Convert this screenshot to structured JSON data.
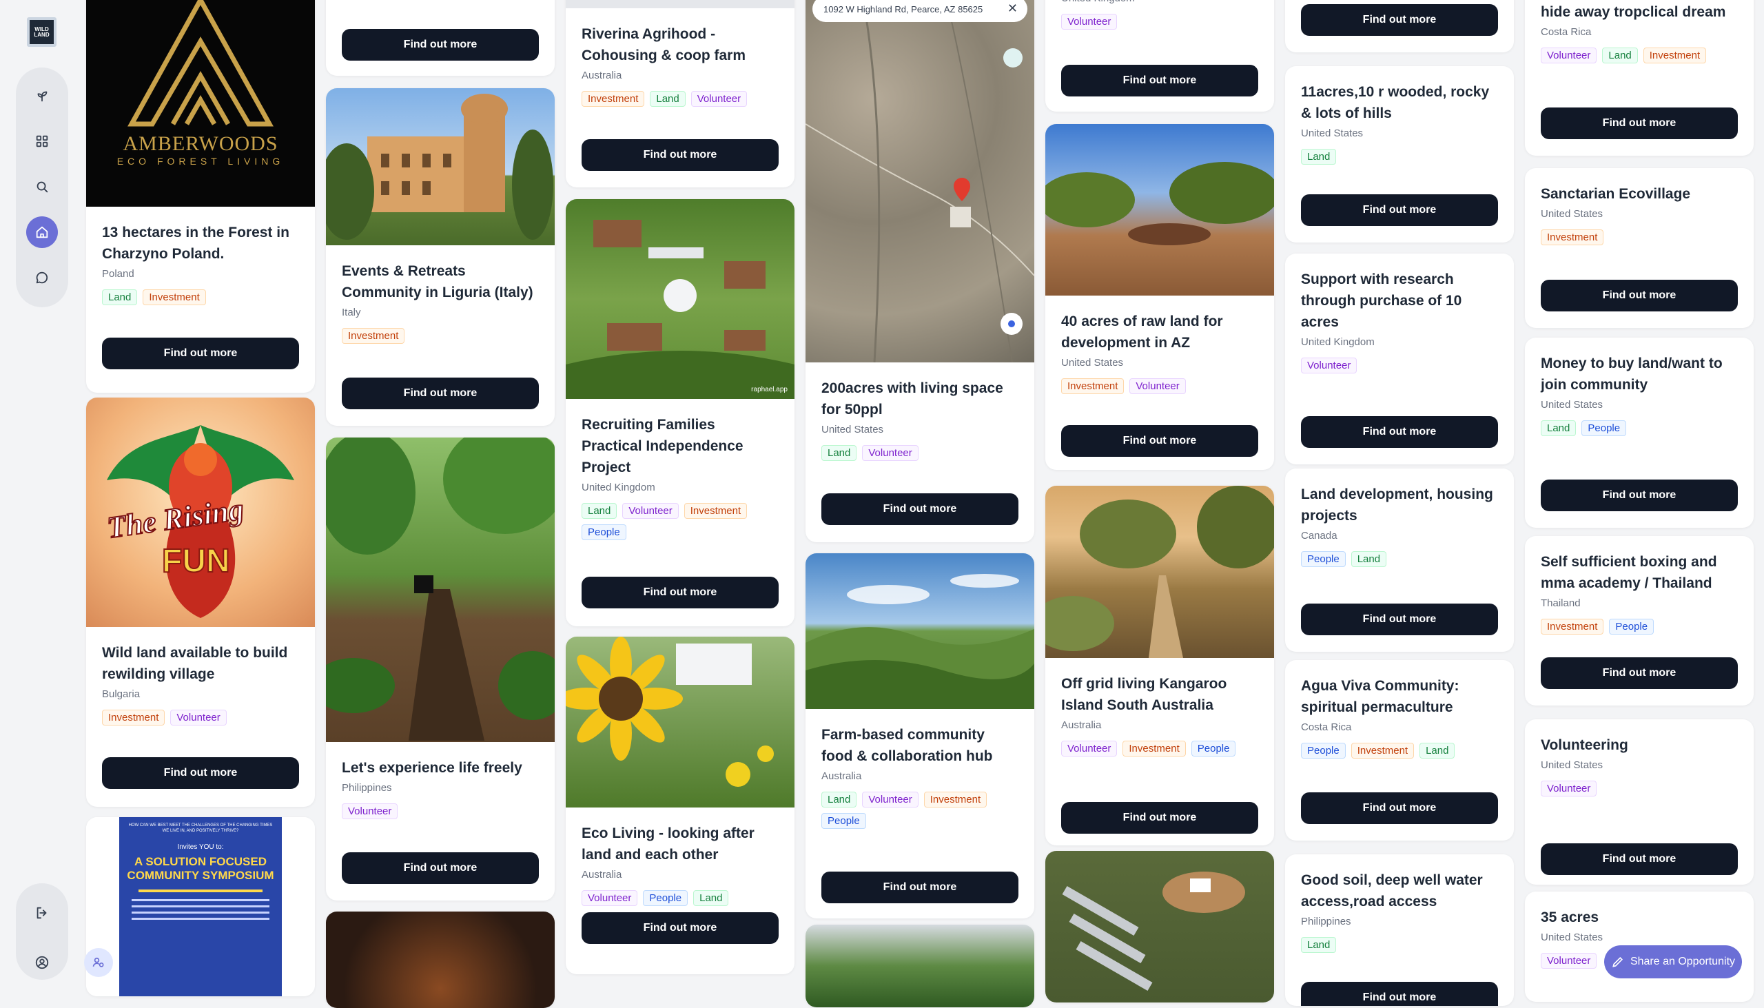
{
  "sidebar": {
    "logo_text": "WILD\nLAND",
    "nav": [
      {
        "name": "sprout-icon"
      },
      {
        "name": "grid-icon"
      },
      {
        "name": "search-icon"
      },
      {
        "name": "home-icon",
        "active": true
      },
      {
        "name": "chat-icon"
      }
    ],
    "bottom": [
      {
        "name": "logout-icon"
      },
      {
        "name": "user-circle-icon"
      }
    ]
  },
  "cta_label": "Find out more",
  "share_label": "Share an Opportunity",
  "map_address": "1092 W Highland Rd, Pearce, AZ 85625",
  "columns": [
    [
      {
        "title": "13 hectares in the Forest in Charzyno Poland.",
        "country": "Poland",
        "tags": [
          "Land",
          "Investment"
        ],
        "img": "amberwoods"
      },
      {
        "title": "Wild land available to build rewilding village",
        "country": "Bulgaria",
        "tags": [
          "Investment",
          "Volunteer"
        ],
        "img": "phoenix"
      },
      {
        "title": "",
        "country": "",
        "tags": [],
        "img": "poster"
      }
    ],
    [
      {
        "title": "",
        "country": "",
        "tags": [],
        "img": ""
      },
      {
        "title": "Events & Retreats Community in Liguria (Italy)",
        "country": "Italy",
        "tags": [
          "Investment"
        ],
        "img": "castle"
      },
      {
        "title": "Let's experience life freely",
        "country": "Philippines",
        "tags": [
          "Volunteer"
        ],
        "img": "garden"
      },
      {
        "title": "",
        "country": "",
        "tags": [],
        "img": "dark"
      }
    ],
    [
      {
        "title": "Riverina Agrihood - Cohousing & coop farm",
        "country": "Australia",
        "tags": [
          "Investment",
          "Land",
          "Volunteer"
        ],
        "img": ""
      },
      {
        "title": "Recruiting Families Practical Independence Project",
        "country": "United Kingdom",
        "tags": [
          "Land",
          "Volunteer",
          "Investment",
          "People"
        ],
        "img": "farm"
      },
      {
        "title": "Eco Living - looking after land and each other",
        "country": "Australia",
        "tags": [
          "Volunteer",
          "People",
          "Land"
        ],
        "img": "sunflower"
      }
    ],
    [
      {
        "title": "200acres with living space for 50ppl",
        "country": "United States",
        "tags": [
          "Land",
          "Volunteer"
        ],
        "img": "map"
      },
      {
        "title": "Farm-based community food & collaboration hub",
        "country": "Australia",
        "tags": [
          "Land",
          "Volunteer",
          "Investment",
          "People"
        ],
        "img": "hills"
      },
      {
        "title": "",
        "country": "",
        "tags": [],
        "img": "forest"
      }
    ],
    [
      {
        "title": "",
        "country": "United Kingdom",
        "tags": [
          "Volunteer"
        ],
        "img": ""
      },
      {
        "title": "40 acres of raw land for development in AZ",
        "country": "United States",
        "tags": [
          "Investment",
          "Volunteer"
        ],
        "img": "desert"
      },
      {
        "title": "Off grid living Kangaroo Island South Australia",
        "country": "Australia",
        "tags": [
          "Volunteer",
          "Investment",
          "People"
        ],
        "img": "bush"
      },
      {
        "title": "",
        "country": "",
        "tags": [],
        "img": "aerial"
      }
    ],
    [
      {
        "title": "",
        "country": "",
        "tags": [],
        "img": ""
      },
      {
        "title": "11acres,10 r wooded, rocky & lots of hills",
        "country": "United States",
        "tags": [
          "Land"
        ],
        "img": ""
      },
      {
        "title": "Support with research through purchase of 10 acres",
        "country": "United Kingdom",
        "tags": [
          "Volunteer"
        ],
        "img": ""
      },
      {
        "title": "Land development, housing projects",
        "country": "Canada",
        "tags": [
          "People",
          "Land"
        ],
        "img": ""
      },
      {
        "title": "Agua Viva Community: spiritual permaculture",
        "country": "Costa Rica",
        "tags": [
          "People",
          "Investment",
          "Land"
        ],
        "img": ""
      },
      {
        "title": "Good soil, deep well water access,road access",
        "country": "Philippines",
        "tags": [
          "Land"
        ],
        "img": ""
      }
    ],
    [
      {
        "title": "hide away tropclical dream",
        "country": "Costa Rica",
        "tags": [
          "Volunteer",
          "Land",
          "Investment"
        ],
        "img": ""
      },
      {
        "title": "Sanctarian Ecovillage",
        "country": "United States",
        "tags": [
          "Investment"
        ],
        "img": ""
      },
      {
        "title": "Money to buy land/want to join community",
        "country": "United States",
        "tags": [
          "Land",
          "People"
        ],
        "img": ""
      },
      {
        "title": "Self sufficient boxing and mma academy / Thailand",
        "country": "Thailand",
        "tags": [
          "Investment",
          "People"
        ],
        "img": ""
      },
      {
        "title": "Volunteering",
        "country": "United States",
        "tags": [
          "Volunteer"
        ],
        "img": ""
      },
      {
        "title": "35 acres",
        "country": "United States",
        "tags": [
          "Volunteer"
        ],
        "img": ""
      }
    ]
  ],
  "images": {
    "amberwoods": {
      "brand": "AMBERWOODS",
      "tagline": "ECO FOREST LIVING"
    },
    "phoenix": {
      "line1": "The Rising",
      "line2": "FUN"
    },
    "poster": {
      "heading": "A SOLUTION FOCUSED COMMUNITY SYMPOSIUM",
      "lead": "HOW CAN WE BEST MEET THE CHALLENGES OF THE CHANGING TIMES WE LIVE IN, AND POSITIVELY THRIVE?",
      "invite": "Invites YOU to:"
    },
    "farm": {
      "credit": "raphael.app"
    }
  }
}
